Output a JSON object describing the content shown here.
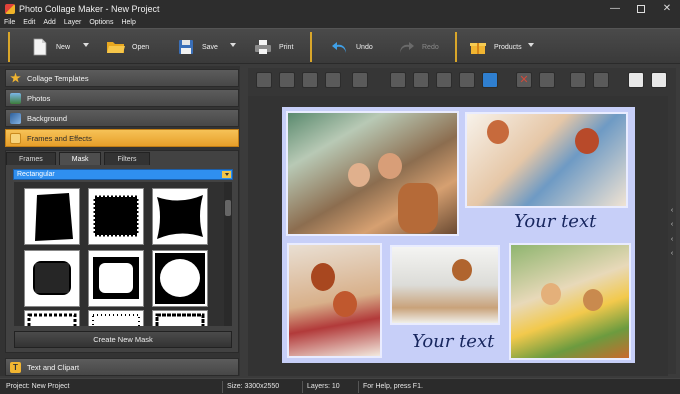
{
  "window": {
    "title": "Photo Collage Maker - New Project"
  },
  "menu": [
    "File",
    "Edit",
    "Add",
    "Layer",
    "Options",
    "Help"
  ],
  "toolbar": {
    "new": "New",
    "open": "Open",
    "save": "Save",
    "print": "Print",
    "undo": "Undo",
    "redo": "Redo",
    "products": "Products"
  },
  "sidebar": {
    "sections": [
      "Collage Templates",
      "Photos",
      "Background",
      "Frames and Effects"
    ],
    "bottom_section": "Text and Clipart",
    "tabs": [
      "Frames",
      "Mask",
      "Filters"
    ],
    "active_tab": "Mask",
    "mask_type": "Rectangular",
    "create_button": "Create New Mask"
  },
  "canvas": {
    "captions": [
      "Your text",
      "Your text"
    ]
  },
  "status": {
    "project": "Project: New Project",
    "size": "Size: 3300x2550",
    "layers": "Layers: 10",
    "help": "For Help, press F1."
  },
  "colors": {
    "accent": "#f0b040",
    "page_bg": "#c7cff8",
    "select_bg": "#2f8ff0"
  }
}
